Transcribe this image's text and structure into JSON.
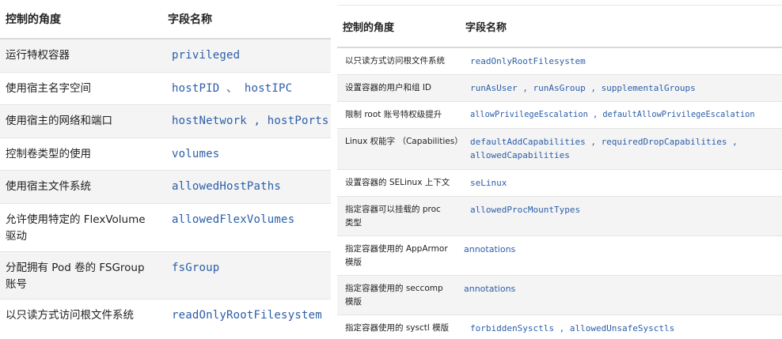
{
  "left_table": {
    "header": {
      "col1": "控制的角度",
      "col2": "字段名称"
    },
    "rows": [
      {
        "aspect": "运行特权容器",
        "field": "privileged"
      },
      {
        "aspect": "使用宿主名字空间",
        "field": "hostPID 、 hostIPC"
      },
      {
        "aspect": "使用宿主的网络和端口",
        "field": "hostNetwork , hostPorts"
      },
      {
        "aspect": "控制卷类型的使用",
        "field": "volumes"
      },
      {
        "aspect": "使用宿主文件系统",
        "field": "allowedHostPaths"
      },
      {
        "aspect": "允许使用特定的 FlexVolume 驱动",
        "field": "allowedFlexVolumes"
      },
      {
        "aspect": "分配拥有 Pod 卷的 FSGroup 账号",
        "field": "fsGroup"
      },
      {
        "aspect": "以只读方式访问根文件系统",
        "field": "readOnlyRootFilesystem"
      }
    ]
  },
  "right_table": {
    "header": {
      "col1": "控制的角度",
      "col2": "字段名称"
    },
    "rows": [
      {
        "aspect": "以只读方式访问根文件系统",
        "field": "readOnlyRootFilesystem"
      },
      {
        "aspect": "设置容器的用户和组 ID",
        "field": "runAsUser , runAsGroup , supplementalGroups"
      },
      {
        "aspect": "限制 root 账号特权级提升",
        "field": "allowPrivilegeEscalation , defaultAllowPrivilegeEscalation"
      },
      {
        "aspect": "Linux 权能字 （Capabilities）",
        "field": "defaultAddCapabilities , requiredDropCapabilities , allowedCapabilities"
      },
      {
        "aspect": "设置容器的 SELinux 上下文",
        "field": "seLinux"
      },
      {
        "aspect": "指定容器可以挂载的 proc 类型",
        "field": "allowedProcMountTypes"
      },
      {
        "aspect": "指定容器使用的 AppArmor 模版",
        "field": "annotations"
      },
      {
        "aspect": "指定容器使用的 seccomp 模版",
        "field": "annotations"
      },
      {
        "aspect": "指定容器使用的 sysctl 模版",
        "field": "forbiddenSysctls , allowedUnsafeSysctls"
      }
    ]
  }
}
